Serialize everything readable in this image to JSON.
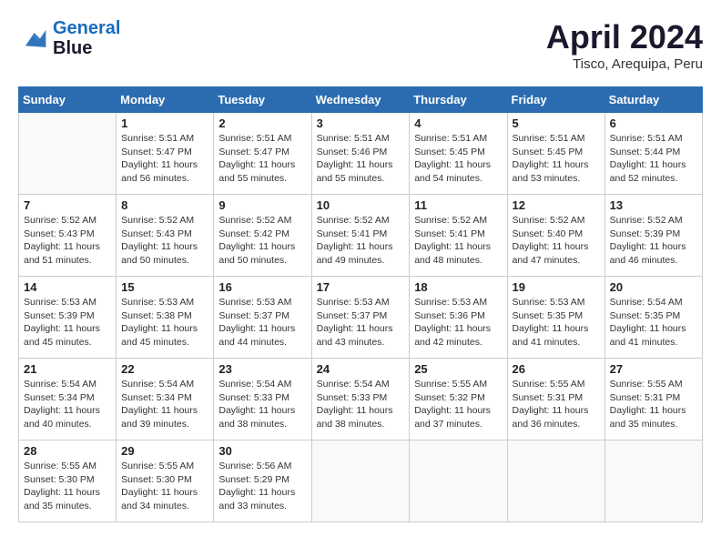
{
  "header": {
    "logo_line1": "General",
    "logo_line2": "Blue",
    "month": "April 2024",
    "location": "Tisco, Arequipa, Peru"
  },
  "weekdays": [
    "Sunday",
    "Monday",
    "Tuesday",
    "Wednesday",
    "Thursday",
    "Friday",
    "Saturday"
  ],
  "weeks": [
    [
      {
        "day": "",
        "info": ""
      },
      {
        "day": "1",
        "info": "Sunrise: 5:51 AM\nSunset: 5:47 PM\nDaylight: 11 hours\nand 56 minutes."
      },
      {
        "day": "2",
        "info": "Sunrise: 5:51 AM\nSunset: 5:47 PM\nDaylight: 11 hours\nand 55 minutes."
      },
      {
        "day": "3",
        "info": "Sunrise: 5:51 AM\nSunset: 5:46 PM\nDaylight: 11 hours\nand 55 minutes."
      },
      {
        "day": "4",
        "info": "Sunrise: 5:51 AM\nSunset: 5:45 PM\nDaylight: 11 hours\nand 54 minutes."
      },
      {
        "day": "5",
        "info": "Sunrise: 5:51 AM\nSunset: 5:45 PM\nDaylight: 11 hours\nand 53 minutes."
      },
      {
        "day": "6",
        "info": "Sunrise: 5:51 AM\nSunset: 5:44 PM\nDaylight: 11 hours\nand 52 minutes."
      }
    ],
    [
      {
        "day": "7",
        "info": "Sunrise: 5:52 AM\nSunset: 5:43 PM\nDaylight: 11 hours\nand 51 minutes."
      },
      {
        "day": "8",
        "info": "Sunrise: 5:52 AM\nSunset: 5:43 PM\nDaylight: 11 hours\nand 50 minutes."
      },
      {
        "day": "9",
        "info": "Sunrise: 5:52 AM\nSunset: 5:42 PM\nDaylight: 11 hours\nand 50 minutes."
      },
      {
        "day": "10",
        "info": "Sunrise: 5:52 AM\nSunset: 5:41 PM\nDaylight: 11 hours\nand 49 minutes."
      },
      {
        "day": "11",
        "info": "Sunrise: 5:52 AM\nSunset: 5:41 PM\nDaylight: 11 hours\nand 48 minutes."
      },
      {
        "day": "12",
        "info": "Sunrise: 5:52 AM\nSunset: 5:40 PM\nDaylight: 11 hours\nand 47 minutes."
      },
      {
        "day": "13",
        "info": "Sunrise: 5:52 AM\nSunset: 5:39 PM\nDaylight: 11 hours\nand 46 minutes."
      }
    ],
    [
      {
        "day": "14",
        "info": "Sunrise: 5:53 AM\nSunset: 5:39 PM\nDaylight: 11 hours\nand 45 minutes."
      },
      {
        "day": "15",
        "info": "Sunrise: 5:53 AM\nSunset: 5:38 PM\nDaylight: 11 hours\nand 45 minutes."
      },
      {
        "day": "16",
        "info": "Sunrise: 5:53 AM\nSunset: 5:37 PM\nDaylight: 11 hours\nand 44 minutes."
      },
      {
        "day": "17",
        "info": "Sunrise: 5:53 AM\nSunset: 5:37 PM\nDaylight: 11 hours\nand 43 minutes."
      },
      {
        "day": "18",
        "info": "Sunrise: 5:53 AM\nSunset: 5:36 PM\nDaylight: 11 hours\nand 42 minutes."
      },
      {
        "day": "19",
        "info": "Sunrise: 5:53 AM\nSunset: 5:35 PM\nDaylight: 11 hours\nand 41 minutes."
      },
      {
        "day": "20",
        "info": "Sunrise: 5:54 AM\nSunset: 5:35 PM\nDaylight: 11 hours\nand 41 minutes."
      }
    ],
    [
      {
        "day": "21",
        "info": "Sunrise: 5:54 AM\nSunset: 5:34 PM\nDaylight: 11 hours\nand 40 minutes."
      },
      {
        "day": "22",
        "info": "Sunrise: 5:54 AM\nSunset: 5:34 PM\nDaylight: 11 hours\nand 39 minutes."
      },
      {
        "day": "23",
        "info": "Sunrise: 5:54 AM\nSunset: 5:33 PM\nDaylight: 11 hours\nand 38 minutes."
      },
      {
        "day": "24",
        "info": "Sunrise: 5:54 AM\nSunset: 5:33 PM\nDaylight: 11 hours\nand 38 minutes."
      },
      {
        "day": "25",
        "info": "Sunrise: 5:55 AM\nSunset: 5:32 PM\nDaylight: 11 hours\nand 37 minutes."
      },
      {
        "day": "26",
        "info": "Sunrise: 5:55 AM\nSunset: 5:31 PM\nDaylight: 11 hours\nand 36 minutes."
      },
      {
        "day": "27",
        "info": "Sunrise: 5:55 AM\nSunset: 5:31 PM\nDaylight: 11 hours\nand 35 minutes."
      }
    ],
    [
      {
        "day": "28",
        "info": "Sunrise: 5:55 AM\nSunset: 5:30 PM\nDaylight: 11 hours\nand 35 minutes."
      },
      {
        "day": "29",
        "info": "Sunrise: 5:55 AM\nSunset: 5:30 PM\nDaylight: 11 hours\nand 34 minutes."
      },
      {
        "day": "30",
        "info": "Sunrise: 5:56 AM\nSunset: 5:29 PM\nDaylight: 11 hours\nand 33 minutes."
      },
      {
        "day": "",
        "info": ""
      },
      {
        "day": "",
        "info": ""
      },
      {
        "day": "",
        "info": ""
      },
      {
        "day": "",
        "info": ""
      }
    ]
  ]
}
